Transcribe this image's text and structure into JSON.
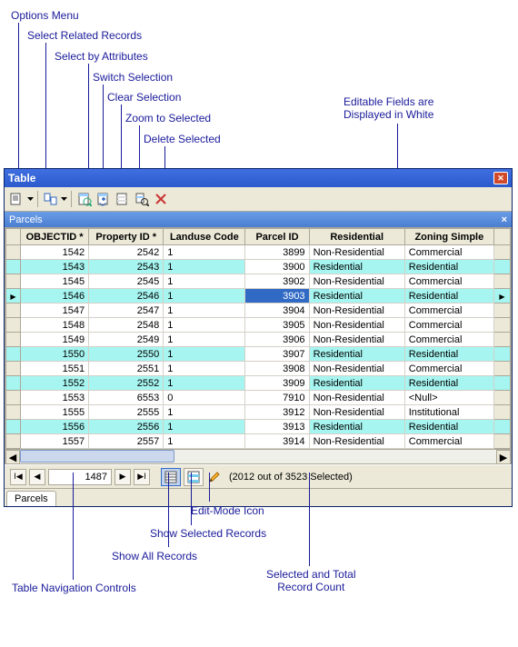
{
  "window": {
    "title": "Table",
    "subtitle": "Parcels"
  },
  "toolbar": {
    "options_menu": "Options Menu",
    "related": "Select Related Records",
    "by_attr": "Select by Attributes",
    "switch_sel": "Switch Selection",
    "clear_sel": "Clear Selection",
    "zoom_sel": "Zoom to Selected",
    "delete_sel": "Delete Selected"
  },
  "columns": [
    "OBJECTID *",
    "Property ID *",
    "Landuse Code",
    "Parcel ID",
    "Residential",
    "Zoning Simple"
  ],
  "rows": [
    {
      "sel": false,
      "cur": false,
      "oid": "1542",
      "pid": "2542",
      "lu": "1",
      "par": "3899",
      "res": "Non-Residential",
      "zon": "Commercial"
    },
    {
      "sel": true,
      "cur": false,
      "oid": "1543",
      "pid": "2543",
      "lu": "1",
      "par": "3900",
      "res": "Residential",
      "zon": "Residential"
    },
    {
      "sel": false,
      "cur": false,
      "oid": "1545",
      "pid": "2545",
      "lu": "1",
      "par": "3902",
      "res": "Non-Residential",
      "zon": "Commercial"
    },
    {
      "sel": true,
      "cur": true,
      "edit": "3903",
      "oid": "1546",
      "pid": "2546",
      "lu": "1",
      "par": "3903",
      "res": "Residential",
      "zon": "Residential"
    },
    {
      "sel": false,
      "cur": false,
      "oid": "1547",
      "pid": "2547",
      "lu": "1",
      "par": "3904",
      "res": "Non-Residential",
      "zon": "Commercial"
    },
    {
      "sel": false,
      "cur": false,
      "oid": "1548",
      "pid": "2548",
      "lu": "1",
      "par": "3905",
      "res": "Non-Residential",
      "zon": "Commercial"
    },
    {
      "sel": false,
      "cur": false,
      "oid": "1549",
      "pid": "2549",
      "lu": "1",
      "par": "3906",
      "res": "Non-Residential",
      "zon": "Commercial"
    },
    {
      "sel": true,
      "cur": false,
      "oid": "1550",
      "pid": "2550",
      "lu": "1",
      "par": "3907",
      "res": "Residential",
      "zon": "Residential"
    },
    {
      "sel": false,
      "cur": false,
      "oid": "1551",
      "pid": "2551",
      "lu": "1",
      "par": "3908",
      "res": "Non-Residential",
      "zon": "Commercial"
    },
    {
      "sel": true,
      "cur": false,
      "oid": "1552",
      "pid": "2552",
      "lu": "1",
      "par": "3909",
      "res": "Residential",
      "zon": "Residential"
    },
    {
      "sel": false,
      "cur": false,
      "oid": "1553",
      "pid": "6553",
      "lu": "0",
      "par": "7910",
      "res": "Non-Residential",
      "zon": "<Null>"
    },
    {
      "sel": false,
      "cur": false,
      "oid": "1555",
      "pid": "2555",
      "lu": "1",
      "par": "3912",
      "res": "Non-Residential",
      "zon": "Institutional"
    },
    {
      "sel": true,
      "cur": false,
      "oid": "1556",
      "pid": "2556",
      "lu": "1",
      "par": "3913",
      "res": "Residential",
      "zon": "Residential"
    },
    {
      "sel": false,
      "cur": false,
      "oid": "1557",
      "pid": "2557",
      "lu": "1",
      "par": "3914",
      "res": "Non-Residential",
      "zon": "Commercial"
    }
  ],
  "nav": {
    "current_record": "1487",
    "count_text": "(2012 out of 3523 Selected)"
  },
  "tab": "Parcels",
  "callouts": {
    "options": "Options Menu",
    "related": "Select Related Records",
    "byattr": "Select by Attributes",
    "switch": "Switch Selection",
    "clear": "Clear Selection",
    "zoom": "Zoom to Selected",
    "delete": "Delete Selected",
    "editable": "Editable Fields are\nDisplayed in White",
    "editmode": "Edit-Mode Icon",
    "showsel": "Show Selected Records",
    "showall": "Show All Records",
    "navctrl": "Table Navigation Controls",
    "count": "Selected and Total\nRecord Count"
  }
}
